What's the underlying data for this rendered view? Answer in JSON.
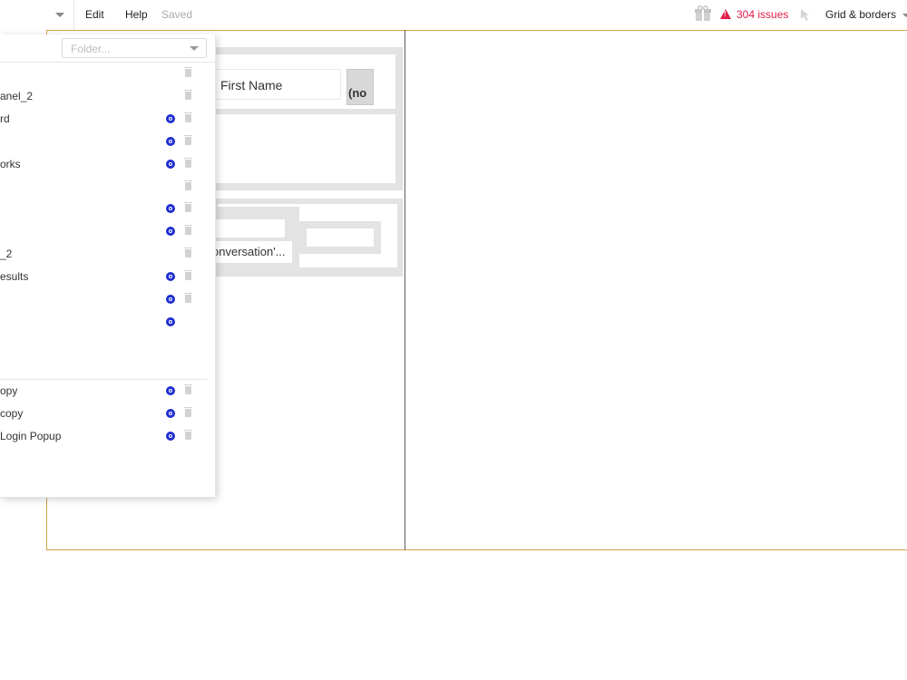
{
  "topbar": {
    "menu": [
      "Edit",
      "Help"
    ],
    "saved": "Saved",
    "issues": "304 issues",
    "grid_label": "Grid & borders",
    "icons": [
      "chevron-down-icon",
      "gift-icon",
      "warning-icon",
      "cursor-icon"
    ],
    "issues_color": "#e11d48"
  },
  "panel": {
    "folder_placeholder": "Folder...",
    "rows": [
      {
        "label": ""
      },
      {
        "label": "anel_2"
      },
      {
        "label": "rd"
      },
      {
        "label": ""
      },
      {
        "label": "orks"
      },
      {
        "label": ""
      },
      {
        "label": ""
      },
      {
        "label": ""
      },
      {
        "label": "_2"
      },
      {
        "label": "esults"
      },
      {
        "label": ""
      },
      {
        "label": ""
      }
    ],
    "rows2": [
      {
        "label": "opy"
      },
      {
        "label": "copy"
      },
      {
        "label": "Login Popup"
      }
    ]
  },
  "canvas": {
    "first_name": "First Name",
    "gray_text": "(no",
    "conversation_text": "onversation'..."
  },
  "colors": {
    "frame": "#d4a24a",
    "link_icon": "#1e2ecf",
    "group_bg": "#e3e3e3"
  }
}
